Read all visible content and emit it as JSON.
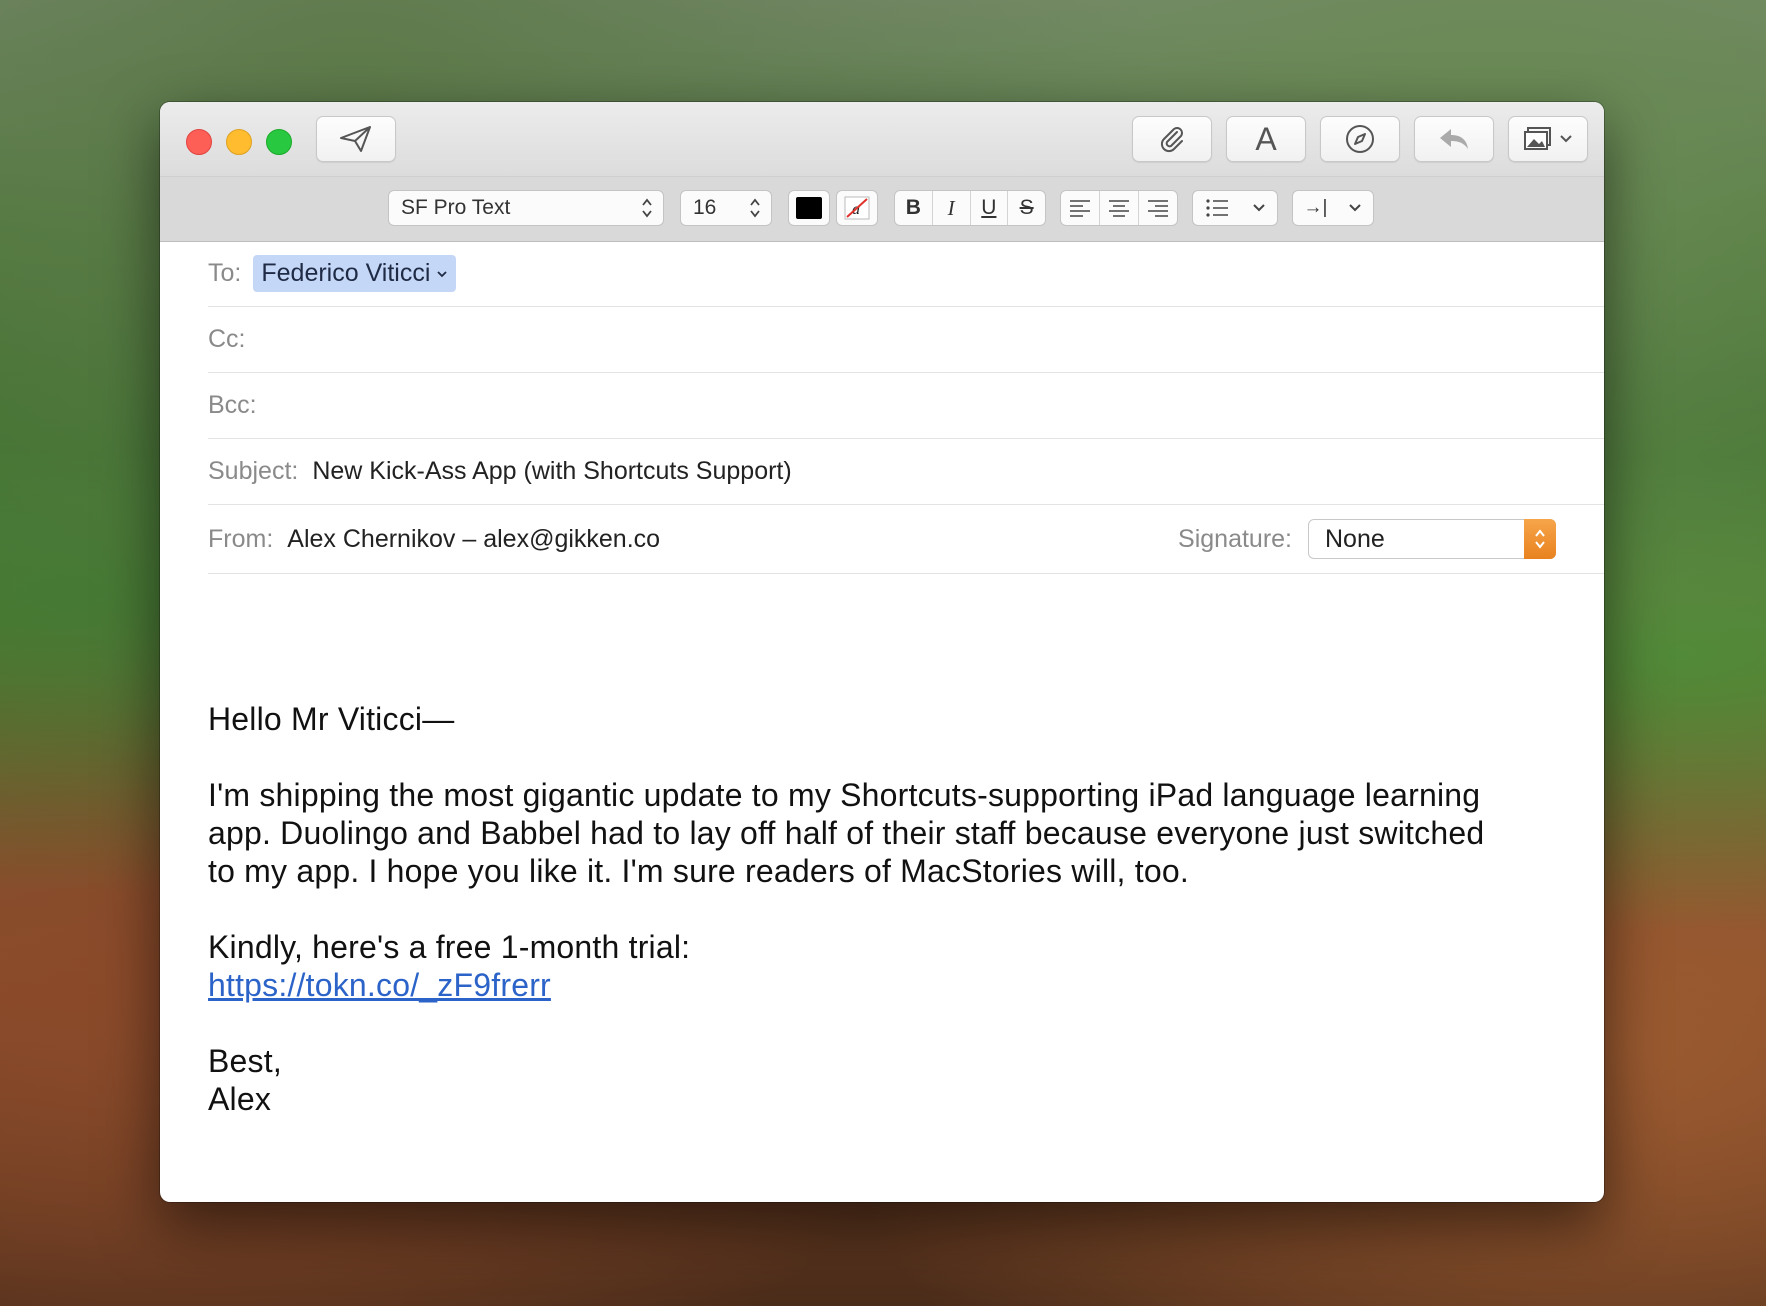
{
  "window": {
    "toolbar": {
      "send_icon": "paper-plane-icon",
      "attach_icon": "paperclip-icon",
      "fonts_label": "A",
      "markup_icon": "compass-icon",
      "reply_icon": "reply-arrow-icon",
      "photo_icon": "photo-browser-icon"
    },
    "format": {
      "font_name": "SF Pro Text",
      "font_size": "16",
      "text_color": "#000000",
      "bold_label": "B",
      "italic_label": "I",
      "underline_label": "U",
      "strike_label": "S",
      "indent_label": "→|"
    }
  },
  "header": {
    "to_label": "To:",
    "to_recipient": "Federico Viticci",
    "cc_label": "Cc:",
    "bcc_label": "Bcc:",
    "subject_label": "Subject:",
    "subject_value": "New Kick-Ass App (with Shortcuts Support)",
    "from_label": "From:",
    "from_value": "Alex Chernikov – alex@gikken.co",
    "signature_label": "Signature:",
    "signature_value": "None"
  },
  "message": {
    "greeting": "Hello Mr Viticci—",
    "line1": "I'm shipping the most gigantic update to my Shortcuts-supporting iPad language learning",
    "line2": "app. Duolingo and Babbel had to lay off half of their staff because everyone just switched",
    "line3": "to my app. I hope you like it. I'm sure readers of MacStories will, too.",
    "trial_line": "Kindly, here's a free 1-month trial:",
    "link": "https://tokn.co/_zF9frerr",
    "closing": "Best,",
    "name": "Alex"
  },
  "colors": {
    "accent_link": "#2b63c9",
    "token_bg": "#c5d7f7",
    "signature_stepper": "#e8821f"
  }
}
